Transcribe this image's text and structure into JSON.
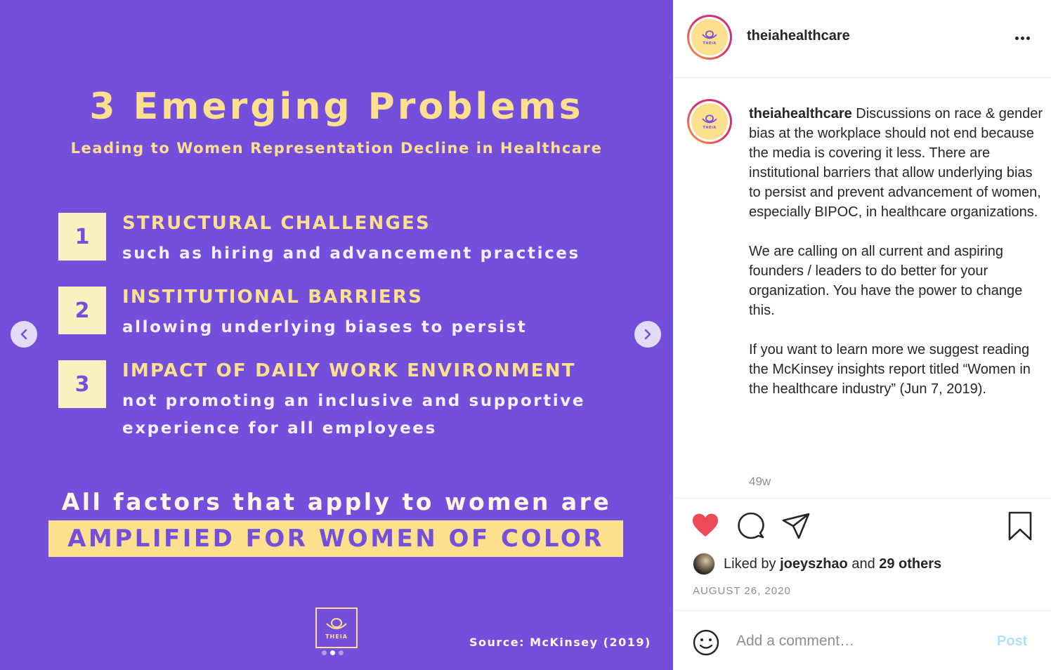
{
  "slide": {
    "title": "3 Emerging Problems",
    "subtitle": "Leading to Women Representation Decline in Healthcare",
    "problems": [
      {
        "num": "1",
        "heading": "STRUCTURAL CHALLENGES",
        "desc": "such as hiring and advancement practices"
      },
      {
        "num": "2",
        "heading": "INSTITUTIONAL BARRIERS",
        "desc": "allowing underlying biases to persist"
      },
      {
        "num": "3",
        "heading": "IMPACT OF DAILY WORK ENVIRONMENT",
        "desc": "not promoting an inclusive and supportive experience for all employees"
      }
    ],
    "factors": "All factors that apply to women are",
    "amplified": "AMPLIFIED FOR WOMEN OF COLOR",
    "logo_text": "THEIA",
    "source": "Source: McKinsey (2019)",
    "dots_total": 3,
    "dots_active": 2,
    "colors": {
      "background": "#744fdb",
      "accent": "#fde08d"
    }
  },
  "carousel": {
    "prev_icon": "chevron-left-icon",
    "next_icon": "chevron-right-icon"
  },
  "header": {
    "username": "theiahealthcare",
    "avatar_text": "THEIA"
  },
  "caption": {
    "username": "theiahealthcare",
    "text": " Discussions on race & gender bias at the workplace should not end because the media is covering it less. There are institutional barriers that allow underlying bias to persist and prevent advancement of women, especially BIPOC, in healthcare organizations.\n\nWe are calling on all current and aspiring founders / leaders to do better for your organization. You have the power to change this.\n\nIf you want to learn more we suggest reading the McKinsey insights report titled “Women in the healthcare industry” (Jun 7, 2019).",
    "timestamp": "49w"
  },
  "actions": {
    "like_icon": "heart-filled-icon",
    "comment_icon": "comment-icon",
    "share_icon": "paper-plane-icon",
    "save_icon": "bookmark-icon",
    "liked_by_prefix": "Liked by ",
    "liked_by_user": "joeyszhao",
    "liked_by_and": " and ",
    "liked_by_others": "29 others",
    "date": "AUGUST 26, 2020",
    "like_color": "#ed4956"
  },
  "comment": {
    "placeholder": "Add a comment…",
    "post_label": "Post",
    "emoji_icon": "smiley-icon"
  }
}
